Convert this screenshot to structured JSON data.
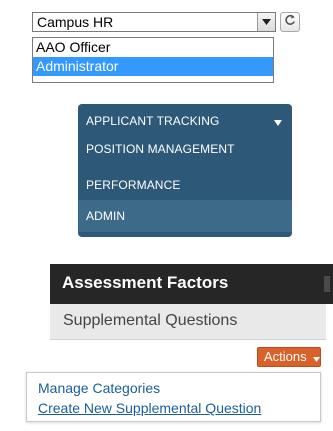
{
  "role_select": {
    "value": "Campus HR",
    "options": [
      "AAO Officer",
      "Administrator"
    ],
    "selected_option": "Administrator"
  },
  "nav_menu": {
    "items": [
      "APPLICANT TRACKING",
      "POSITION MANAGEMENT",
      "PERFORMANCE",
      "ADMIN"
    ]
  },
  "tabs": {
    "active": "Assessment Factors",
    "sub": "Supplemental Questions"
  },
  "actions": {
    "button_label": "Actions",
    "menu_items": [
      "Manage Categories",
      "Create New Supplemental Question"
    ]
  }
}
